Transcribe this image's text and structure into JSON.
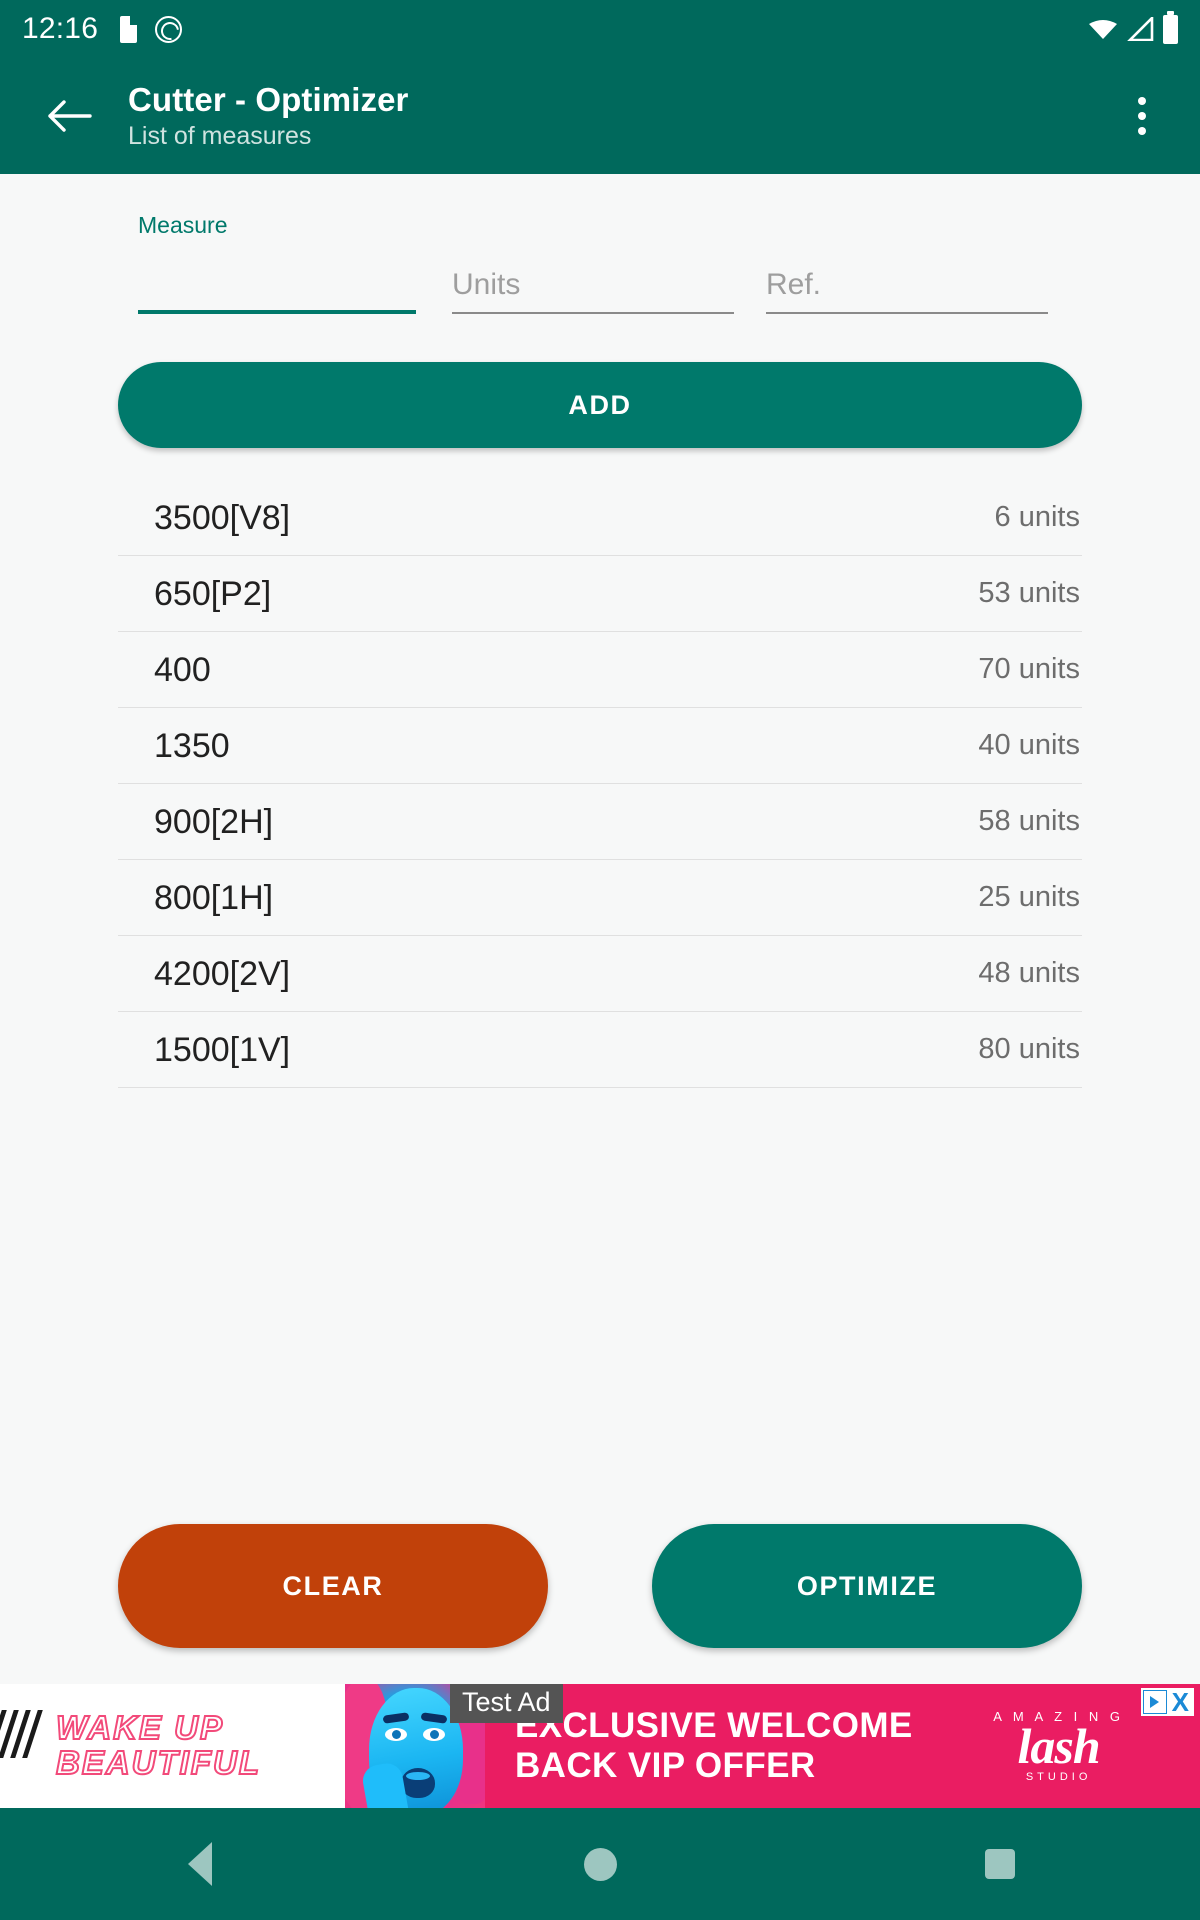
{
  "statusbar": {
    "time": "12:16",
    "icons": [
      "sd-card-icon",
      "do-not-disturb-icon",
      "wifi-icon",
      "signal-icon",
      "battery-icon"
    ]
  },
  "appbar": {
    "back_icon": "back-arrow-icon",
    "title": "Cutter - Optimizer",
    "subtitle": "List of measures",
    "overflow_icon": "more-vert-icon"
  },
  "form": {
    "measure": {
      "label": "Measure",
      "value": "",
      "placeholder": ""
    },
    "units": {
      "label": "",
      "value": "",
      "placeholder": "Units"
    },
    "ref": {
      "label": "",
      "value": "",
      "placeholder": "Ref."
    },
    "add_label": "ADD"
  },
  "list": {
    "rows": [
      {
        "name": "3500[V8]",
        "units": "6 units"
      },
      {
        "name": "650[P2]",
        "units": "53 units"
      },
      {
        "name": "400",
        "units": "70 units"
      },
      {
        "name": "1350",
        "units": "40 units"
      },
      {
        "name": "900[2H]",
        "units": "58 units"
      },
      {
        "name": "800[1H]",
        "units": "25 units"
      },
      {
        "name": "4200[2V]",
        "units": "48 units"
      },
      {
        "name": "1500[1V]",
        "units": "80 units"
      }
    ]
  },
  "actions": {
    "clear_label": "CLEAR",
    "optimize_label": "OPTIMIZE"
  },
  "ad": {
    "badge": "Test Ad",
    "tagline_line1": "WAKE UP",
    "tagline_line2": "BEAUTIFUL",
    "headline_line1": "EXCLUSIVE WELCOME",
    "headline_line2": "BACK VIP OFFER",
    "brand_top": "A M A Z I N G",
    "brand_main": "lash",
    "brand_bottom": "STUDIO",
    "close_label": "X",
    "adchoices_icon": "adchoices-icon"
  },
  "navbar": {
    "back": "nav-back-icon",
    "home": "nav-home-icon",
    "recents": "nav-recents-icon"
  },
  "colors": {
    "primary_dark": "#00695c",
    "primary": "#00796b",
    "clear": "#c1410a",
    "ad_pink": "#ea1d62",
    "background": "#f7f8f8"
  }
}
